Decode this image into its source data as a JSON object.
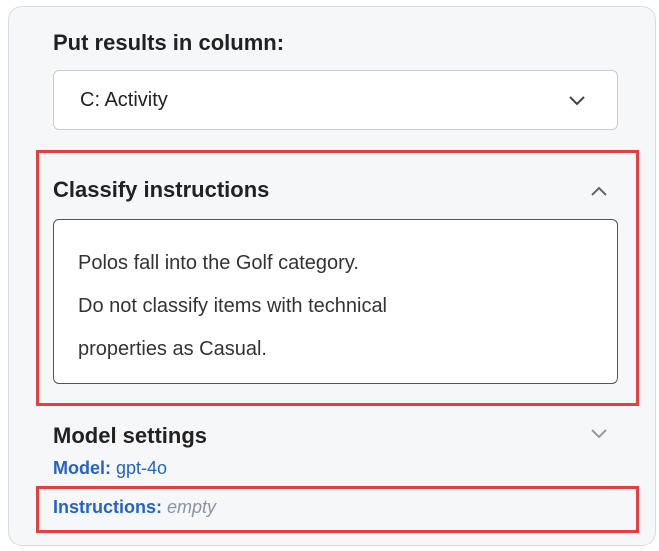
{
  "output_column": {
    "label": "Put results in column:",
    "selected": "C: Activity"
  },
  "classify_instructions": {
    "title": "Classify instructions",
    "lines": [
      "Polos fall into the Golf category.",
      "Do not classify items with technical",
      "properties as Casual."
    ]
  },
  "model_settings": {
    "title": "Model settings",
    "model_key": "Model:",
    "model_value": "gpt-4o",
    "instructions_key": "Instructions:",
    "instructions_value": "empty"
  },
  "colors": {
    "highlight": "#e5403f",
    "link": "#2463c9"
  },
  "icons": {
    "select": "chevron-down-icon",
    "classify_toggle": "chevron-up-icon",
    "model_toggle": "chevron-down-icon"
  }
}
